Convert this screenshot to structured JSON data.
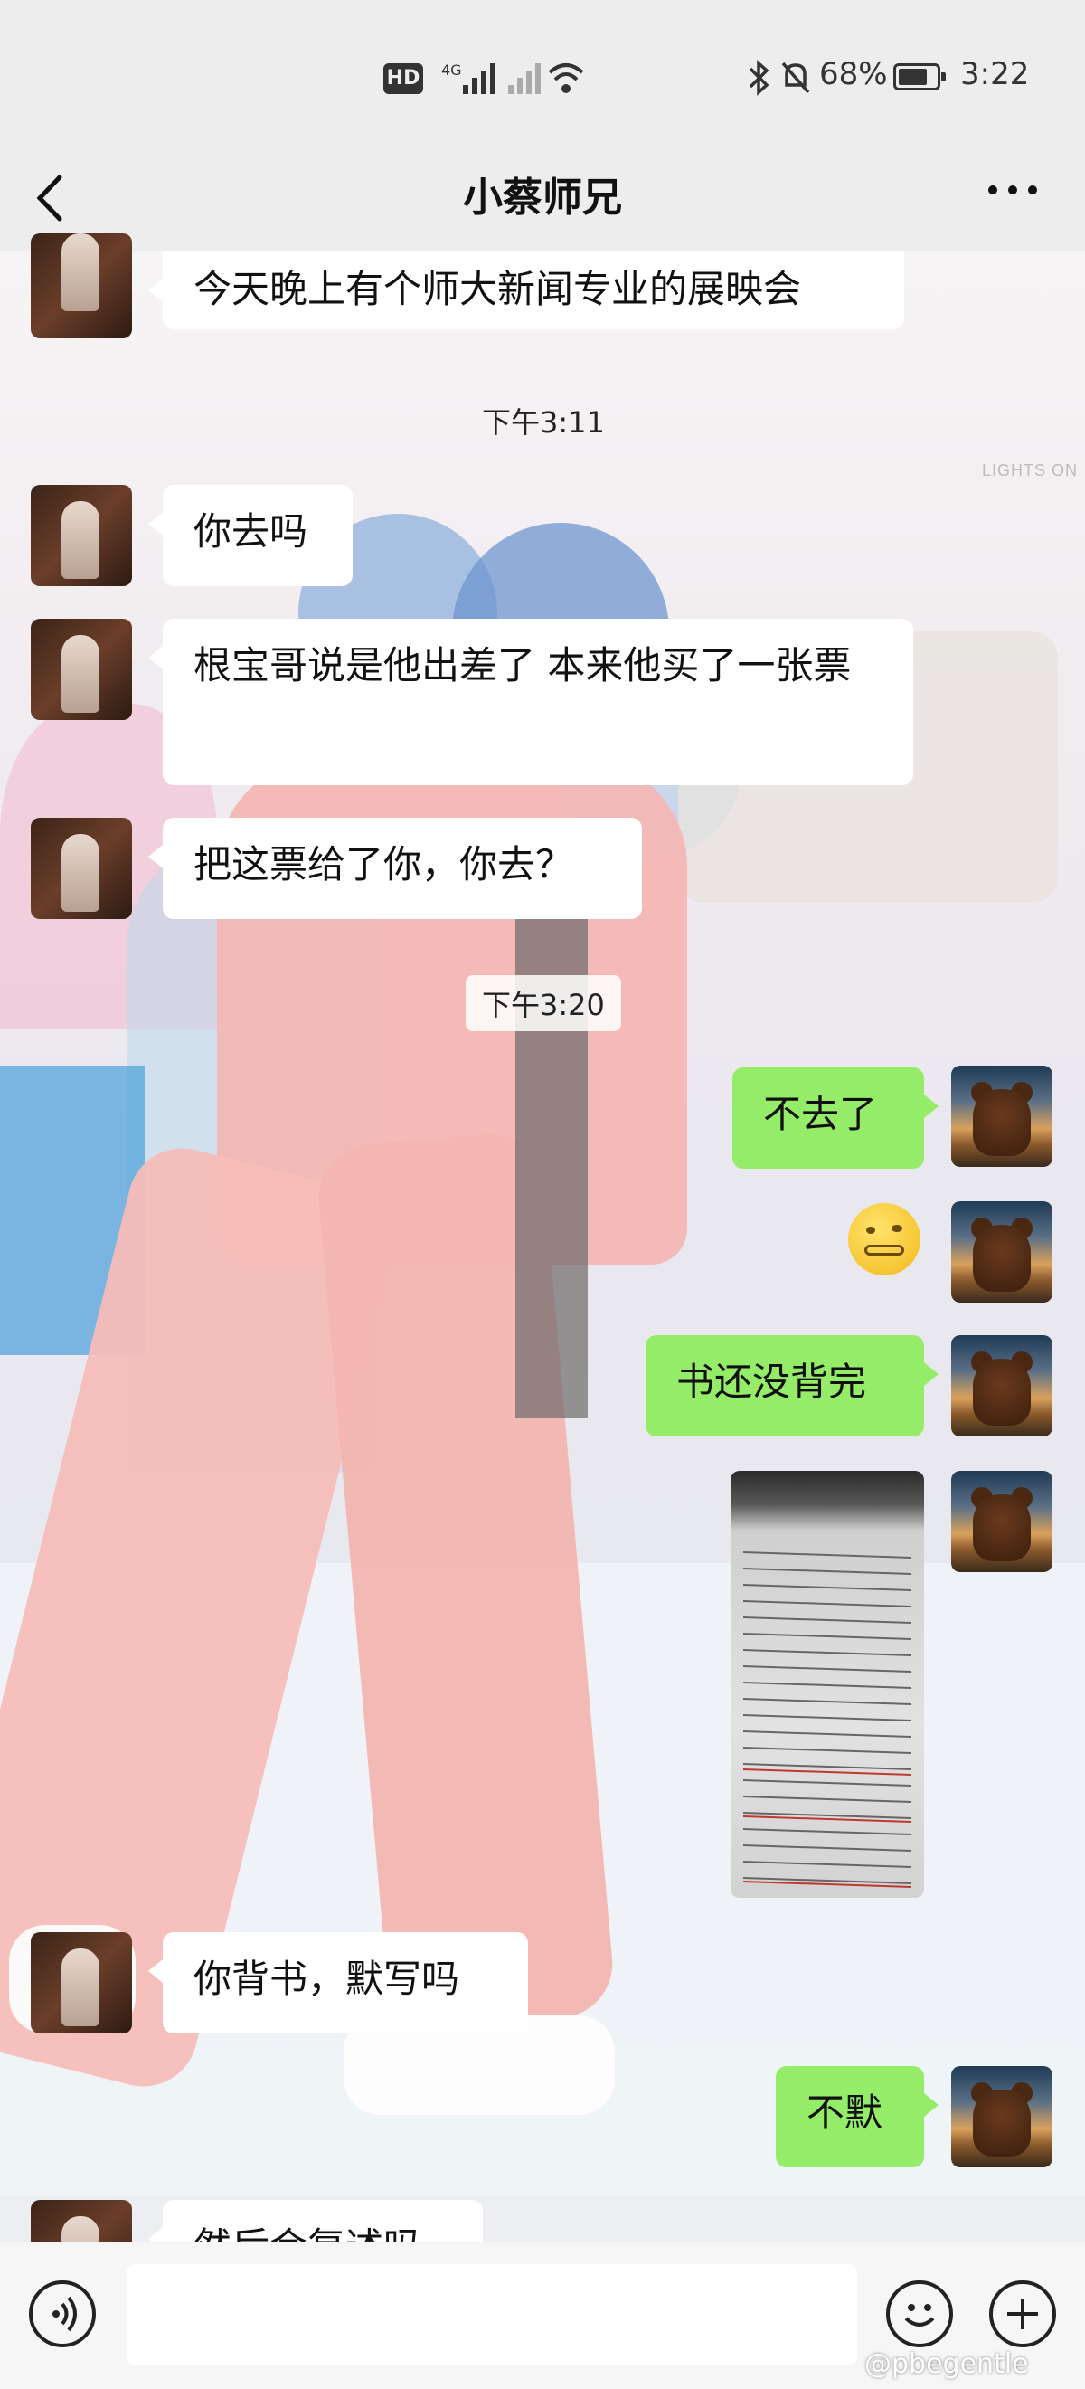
{
  "status_bar": {
    "network": "4G",
    "battery": "68%",
    "time": "3:22"
  },
  "nav": {
    "title": "小蔡师兄"
  },
  "messages": [
    {
      "side": "left",
      "text": "今天晚上有个师大新闻专业的展映会"
    },
    {
      "type": "time",
      "text": "下午3:11"
    },
    {
      "side": "left",
      "text": "你去吗"
    },
    {
      "side": "left",
      "text": "根宝哥说是他出差了 本来他买了一张票"
    },
    {
      "side": "left",
      "text": "把这票给了你，你去？"
    },
    {
      "type": "time",
      "text": "下午3:20"
    },
    {
      "side": "right",
      "text": "不去了"
    },
    {
      "side": "right",
      "sticker": "grimace-emoji"
    },
    {
      "side": "right",
      "text": "书还没背完"
    },
    {
      "side": "right",
      "image": "textbook-page-photo"
    },
    {
      "side": "left",
      "text": "你背书，默写吗"
    },
    {
      "side": "right",
      "text": "不默"
    },
    {
      "side": "left",
      "text": "然后会复述吗"
    }
  ],
  "background": {
    "watermark_text": "LIGHTS ON"
  },
  "footer": {
    "watermark": "@pbegentle"
  },
  "colors": {
    "bubble_right": "#95ec69",
    "bubble_left": "#ffffff",
    "bar_bg": "#ededed"
  }
}
